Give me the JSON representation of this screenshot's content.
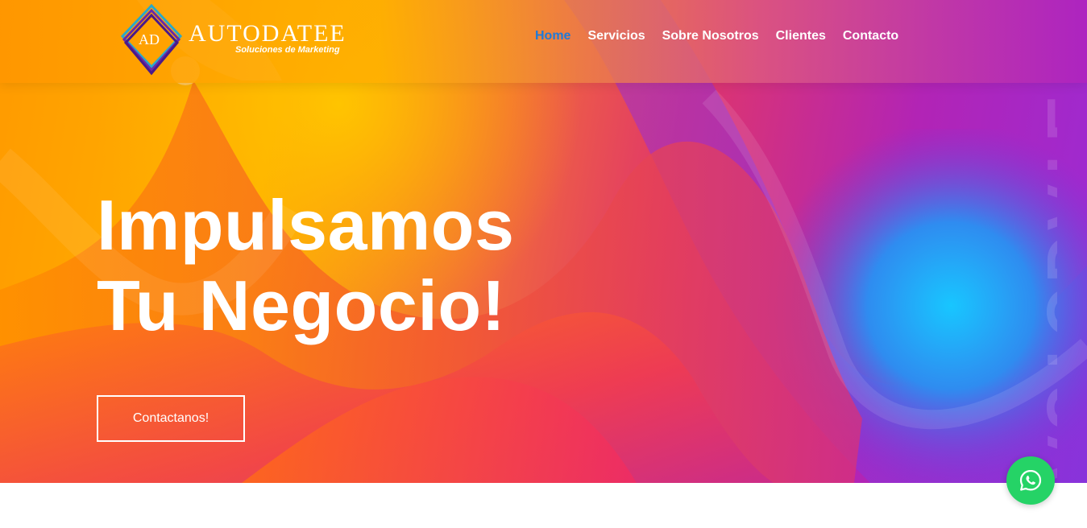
{
  "brand": {
    "logo_initials": "AD",
    "name": "AUTODATEE",
    "tagline": "Soluciones de Marketing"
  },
  "nav": {
    "items": [
      {
        "label": "Home",
        "active": true
      },
      {
        "label": "Servicios",
        "active": false
      },
      {
        "label": "Sobre Nosotros",
        "active": false
      },
      {
        "label": "Clientes",
        "active": false
      },
      {
        "label": "Contacto",
        "active": false
      }
    ]
  },
  "hero": {
    "headline_line1": "Impulsamos",
    "headline_line2": "Tu Negocio!",
    "cta_label": "Contactanos!",
    "watermark": "AUTODATE"
  },
  "floating": {
    "whatsapp_icon": "whatsapp-icon"
  },
  "colors": {
    "accent_nav_active": "#1f7ad8",
    "whatsapp": "#25d366",
    "gradient_orange": "#ff9a00",
    "gradient_magenta": "#e0366a",
    "gradient_purple": "#9a2bd6",
    "gradient_cyan": "#18c6ff"
  }
}
